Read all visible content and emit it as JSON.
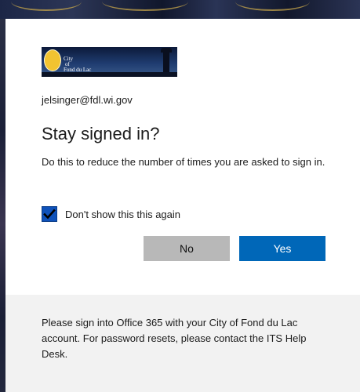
{
  "org": {
    "logo_text_line1": "City",
    "logo_text_line2": "of",
    "logo_text_line3": "Fond du Lac"
  },
  "account": {
    "email": "jelsinger@fdl.wi.gov"
  },
  "prompt": {
    "title": "Stay signed in?",
    "description": "Do this to reduce the number of times you are asked to sign in.",
    "checkbox_label": "Don't show this this again",
    "checkbox_checked": true
  },
  "buttons": {
    "no_label": "No",
    "yes_label": "Yes"
  },
  "footer": {
    "text": "Please sign into Office 365 with your City of Fond du Lac account. For password resets, please contact the ITS Help Desk."
  },
  "colors": {
    "accent": "#0067b8",
    "secondary_button": "#b8b8b8",
    "footer_bg": "#f2f2f2"
  }
}
